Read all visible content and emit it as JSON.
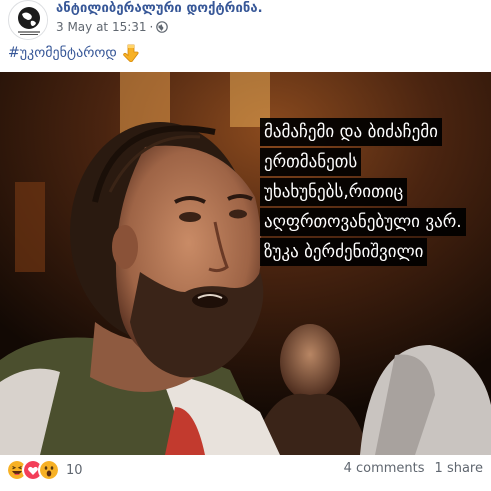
{
  "post": {
    "page_name": "ანტილიბერალური დოქტრინა.",
    "timestamp": "3 May at 15:31",
    "separator": "·",
    "privacy_icon": "globe-icon",
    "caption": {
      "hashtag": "#უკომენტაროდ",
      "emoji": "point-down-icon"
    },
    "image": {
      "quote_lines": [
        "მამაჩემი და ბიძაჩემი",
        "ერთმანეთს",
        "უხახუნებს,რითიც",
        "აღფრთოვანებული ვარ.",
        "ზუკა ბერძენიშვილი"
      ]
    },
    "reactions": {
      "icons": [
        "haha-icon",
        "love-icon",
        "wow-icon"
      ],
      "count": "10"
    },
    "stats": {
      "comments": "4 comments",
      "shares": "1 share"
    }
  },
  "colors": {
    "link_blue": "#385898",
    "meta_gray": "#606770",
    "love_red": "#f33e58",
    "reaction_yellow": "#f7b125"
  }
}
